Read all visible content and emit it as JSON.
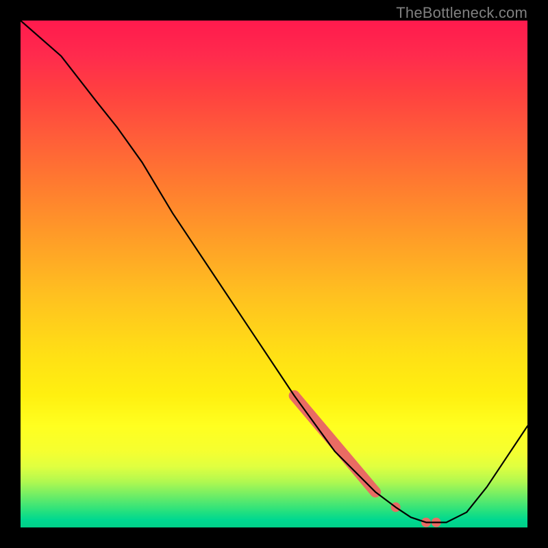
{
  "watermark": "TheBottleneck.com",
  "chart_data": {
    "type": "line",
    "title": "",
    "xlabel": "",
    "ylabel": "",
    "xlim": [
      0,
      100
    ],
    "ylim": [
      0,
      100
    ],
    "grid": false,
    "series": [
      {
        "name": "curve",
        "x": [
          0,
          8,
          15,
          19,
          24,
          30,
          38,
          46,
          54,
          62,
          70,
          74,
          77,
          80,
          84,
          88,
          92,
          100
        ],
        "y": [
          100,
          93,
          84,
          79,
          72,
          62,
          50,
          38,
          26,
          15,
          7,
          4,
          2,
          1,
          1,
          3,
          8,
          20
        ]
      }
    ],
    "highlight_segment": {
      "name": "emphasis",
      "x": [
        54,
        70
      ],
      "y": [
        26,
        7
      ]
    },
    "markers": [
      {
        "x": 74,
        "y": 4
      },
      {
        "x": 80,
        "y": 1
      },
      {
        "x": 82,
        "y": 1
      }
    ],
    "background": "rainbow-vertical",
    "colors": {
      "curve": "#000000",
      "highlight": "#e96b63",
      "frame": "#000000"
    }
  }
}
